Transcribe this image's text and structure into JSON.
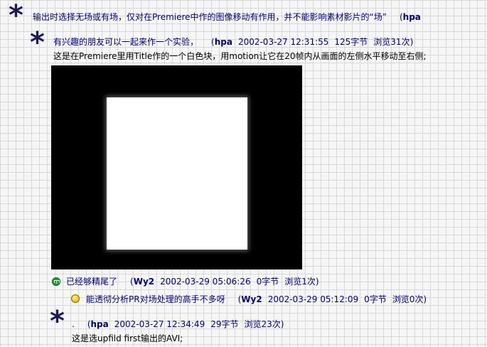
{
  "posts": [
    {
      "title": "输出时选择无场或有场，仅对在Premiere中作的图像移动有作用，并不能影响素材影片的“场”",
      "meta_open": "(",
      "author": "hpa"
    },
    {
      "title": "有兴趣的朋友可以一起来作一个实验，",
      "meta_open": "(",
      "author": "hpa",
      "date": "2002-03-27 12:31:55",
      "size": "125字节",
      "views": "浏览31次)",
      "body": "这是在Premiere里用Title作的一个白色块，用motion让它在20帧内从画面的左侧水平移动至右侧;"
    },
    {
      "title": "已经够精尾了",
      "meta_open": "(",
      "author": "Wy2",
      "date": "2002-03-29 05:06:26",
      "size": "0字节",
      "views": "浏览1次)"
    },
    {
      "title": "能透彻分析PR对场处理的高手不多呀",
      "meta_open": "(",
      "author": "Wy2",
      "date": "2002-03-29 05:12:09",
      "size": "0字节",
      "views": "浏览0次)"
    },
    {
      "title": ".",
      "meta_open": "(",
      "author": "hpa",
      "date": "2002-03-27 12:34:49",
      "size": "29字节",
      "views": "浏览23次)",
      "body": "这是选upfild first输出的AVI;"
    }
  ],
  "icons": {
    "star": "*"
  },
  "colors": {
    "link": "#000080",
    "star": "#1a1a5a",
    "grid_line": "#d8d8d8",
    "background": "#f6f6f6",
    "image_bg": "#000000",
    "image_block": "#ffffff",
    "icon_green": "#1e9e3a",
    "icon_yellow": "#e6c800"
  }
}
